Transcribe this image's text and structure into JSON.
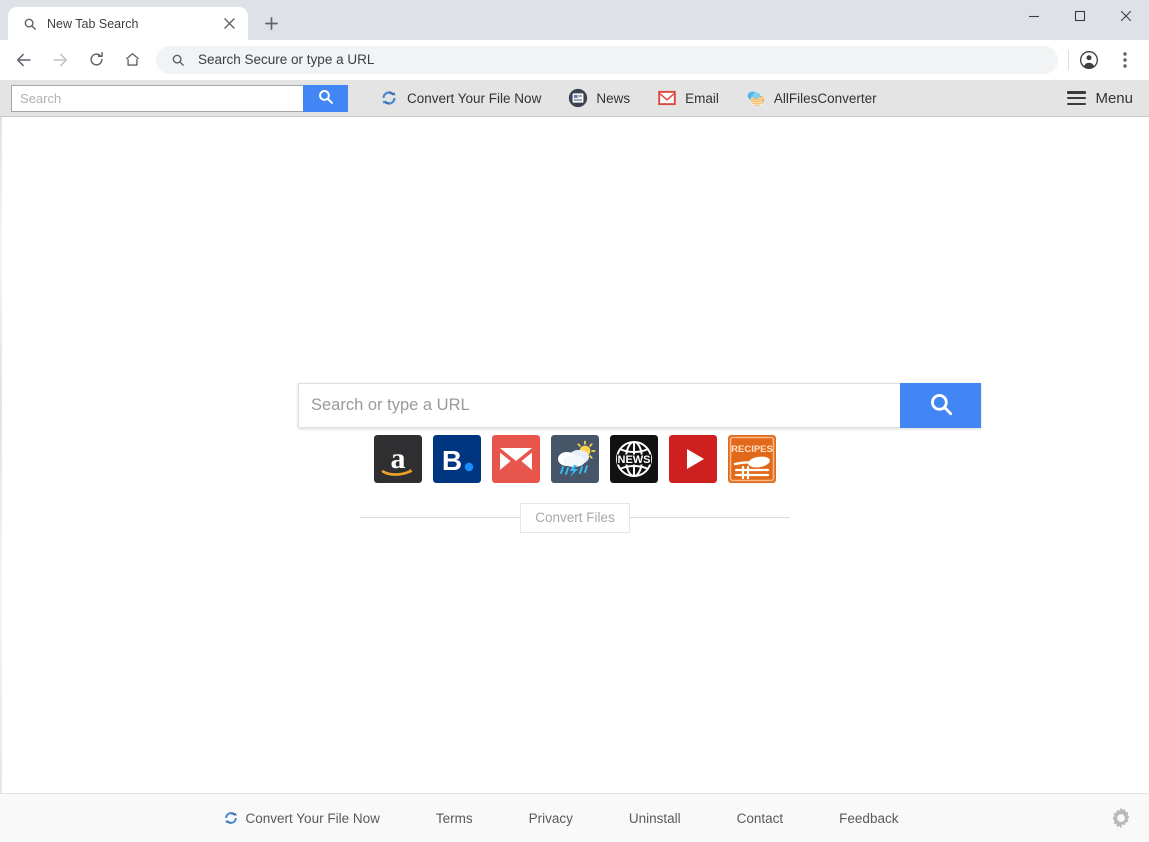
{
  "browser": {
    "tab": {
      "title": "New Tab Search",
      "favicon": "search-icon",
      "close_label": "×",
      "newtab_label": "+"
    },
    "window_controls": {
      "minimize": "—",
      "maximize": "□",
      "close": "✕"
    },
    "nav": {
      "back": "back-arrow-icon",
      "forward": "forward-arrow-icon",
      "reload": "reload-icon",
      "home": "home-icon",
      "profile": "profile-avatar-icon",
      "menu": "three-dot-menu-icon"
    },
    "omnibox": {
      "text": "Search Secure or type a URL",
      "icon": "search-icon"
    }
  },
  "ext_toolbar": {
    "search": {
      "value": "",
      "placeholder": "Search",
      "button_icon": "search-icon",
      "button_color": "#4285f4"
    },
    "links": [
      {
        "label": "Convert Your File Now",
        "icon": "convert-cycle-icon"
      },
      {
        "label": "News",
        "icon": "news-paper-icon"
      },
      {
        "label": "Email",
        "icon": "email-envelope-icon"
      },
      {
        "label": "AllFilesConverter",
        "icon": "allfilesconverter-icon"
      }
    ],
    "menu": {
      "label": "Menu",
      "icon": "hamburger-icon"
    }
  },
  "main": {
    "search": {
      "value": "",
      "placeholder": "Search or type a URL",
      "button_icon": "search-icon",
      "button_color": "#4285f4"
    },
    "shortcuts": [
      {
        "name": "amazon",
        "label": "a",
        "bg": "#2f2f31"
      },
      {
        "name": "booking",
        "label": "B.",
        "bg": "#003580"
      },
      {
        "name": "email",
        "label": "envelope",
        "bg": "#e8554d"
      },
      {
        "name": "weather",
        "label": "cloud-sun-rain",
        "bg": "#475569"
      },
      {
        "name": "news",
        "label": "NEWS",
        "bg": "#111111"
      },
      {
        "name": "video",
        "label": "play",
        "bg": "#cf2020"
      },
      {
        "name": "recipes",
        "label": "RECIPES",
        "bg": "#e2691a"
      }
    ],
    "convert_files_label": "Convert Files"
  },
  "footer": {
    "links": [
      {
        "label": "Convert Your File Now",
        "icon": "convert-cycle-icon"
      },
      {
        "label": "Terms",
        "icon": ""
      },
      {
        "label": "Privacy",
        "icon": ""
      },
      {
        "label": "Uninstall",
        "icon": ""
      },
      {
        "label": "Contact",
        "icon": ""
      },
      {
        "label": "Feedback",
        "icon": ""
      }
    ],
    "settings_icon": "gear-icon"
  }
}
